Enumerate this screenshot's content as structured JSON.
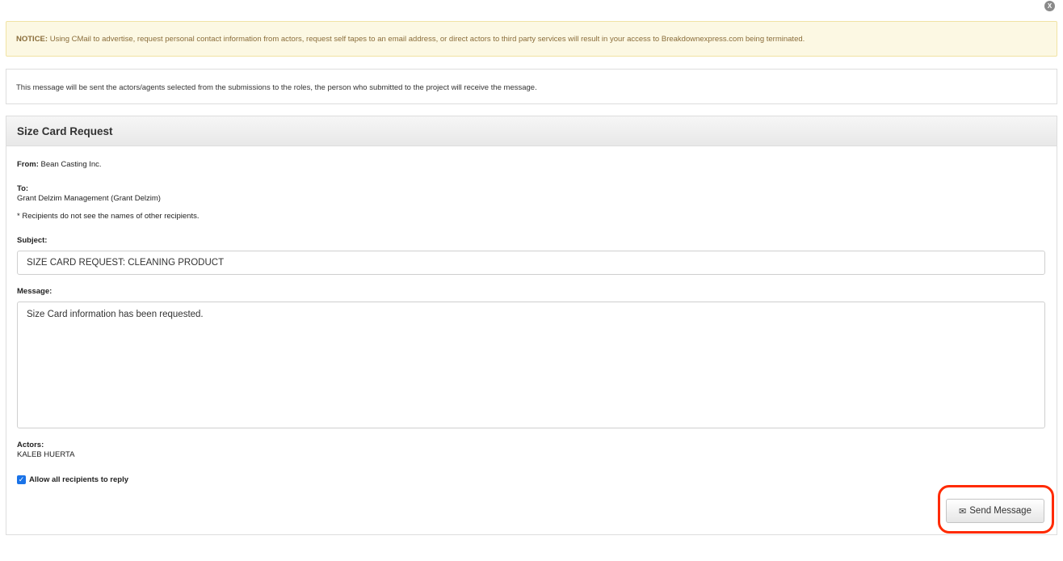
{
  "close": {
    "glyph": "X",
    "icon": "close-icon"
  },
  "notice": {
    "label": "NOTICE:",
    "text": " Using CMail to advertise, request personal contact information from actors, request self tapes to an email address, or direct actors to third party services will result in your access to Breakdownexpress.com being terminated."
  },
  "info": {
    "text": "This message will be sent the actors/agents selected from the submissions to the roles, the person who submitted to the project will receive the message."
  },
  "panel": {
    "title": "Size Card Request",
    "from_label": "From:",
    "from_value": " Bean Casting Inc.",
    "to_label": "To:",
    "to_value": "Grant Delzim Management (Grant Delzim)",
    "recipients_note": "* Recipients do not see the names of other recipients.",
    "subject_label": "Subject:",
    "subject_value": "SIZE CARD REQUEST: CLEANING PRODUCT",
    "message_label": "Message:",
    "message_value": "Size Card information has been requested.",
    "actors_label": "Actors:",
    "actors_value": "KALEB HUERTA",
    "reply_label": "Allow all recipients to reply",
    "reply_checked": true,
    "send_label": "Send Message",
    "send_icon": "envelope-icon"
  },
  "colors": {
    "notice_bg": "#fcf8e3",
    "notice_text": "#8a6d3b",
    "highlight": "#ff2a00",
    "checkbox": "#1a73e8"
  }
}
